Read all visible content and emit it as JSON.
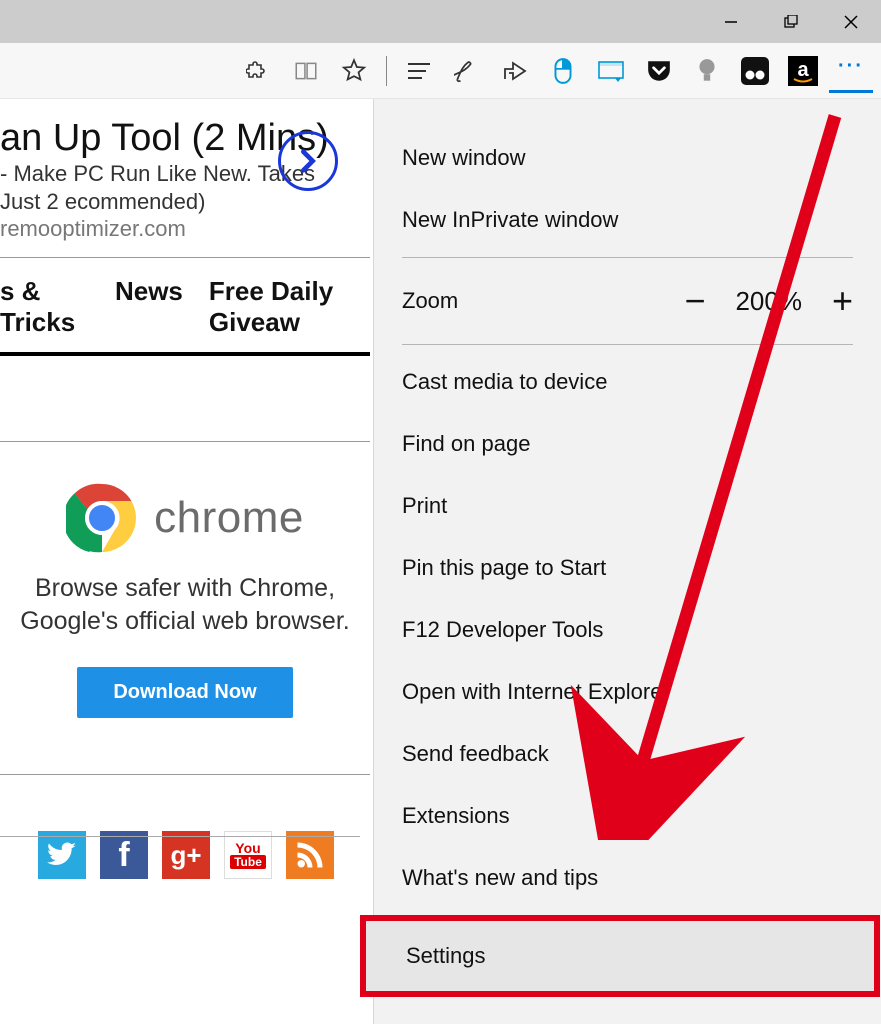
{
  "toolbar": {
    "icons": [
      "puzzle",
      "book",
      "star",
      "sep",
      "lines",
      "pen",
      "share",
      "mouse",
      "panel",
      "pocket",
      "bulb",
      "dots2",
      "amazon",
      "more"
    ]
  },
  "ad": {
    "title_fragment": "an Up Tool (2 Mins)",
    "sub_line1_fragment": "- Make PC Run Like New. Takes Just 2",
    "sub_line2_fragment": "ecommended) ",
    "domain": "remooptimizer.com"
  },
  "nav": {
    "items": [
      "s & Tricks",
      "News",
      "Free Daily Giveaw"
    ]
  },
  "chrome": {
    "word": "chrome",
    "line1": "Browse safer with Chrome,",
    "line2": "Google's official web browser.",
    "button": "Download Now"
  },
  "menu": {
    "new_window": "New window",
    "new_inprivate": "New InPrivate window",
    "zoom_label": "Zoom",
    "zoom_value": "200%",
    "cast": "Cast media to device",
    "find": "Find on page",
    "print": "Print",
    "pin": "Pin this page to Start",
    "devtools": "F12 Developer Tools",
    "open_ie": "Open with Internet Explorer",
    "feedback": "Send feedback",
    "extensions": "Extensions",
    "whatsnew": "What's new and tips",
    "settings": "Settings"
  },
  "social": {
    "youtube_top": "You",
    "youtube_bottom": "Tube"
  }
}
